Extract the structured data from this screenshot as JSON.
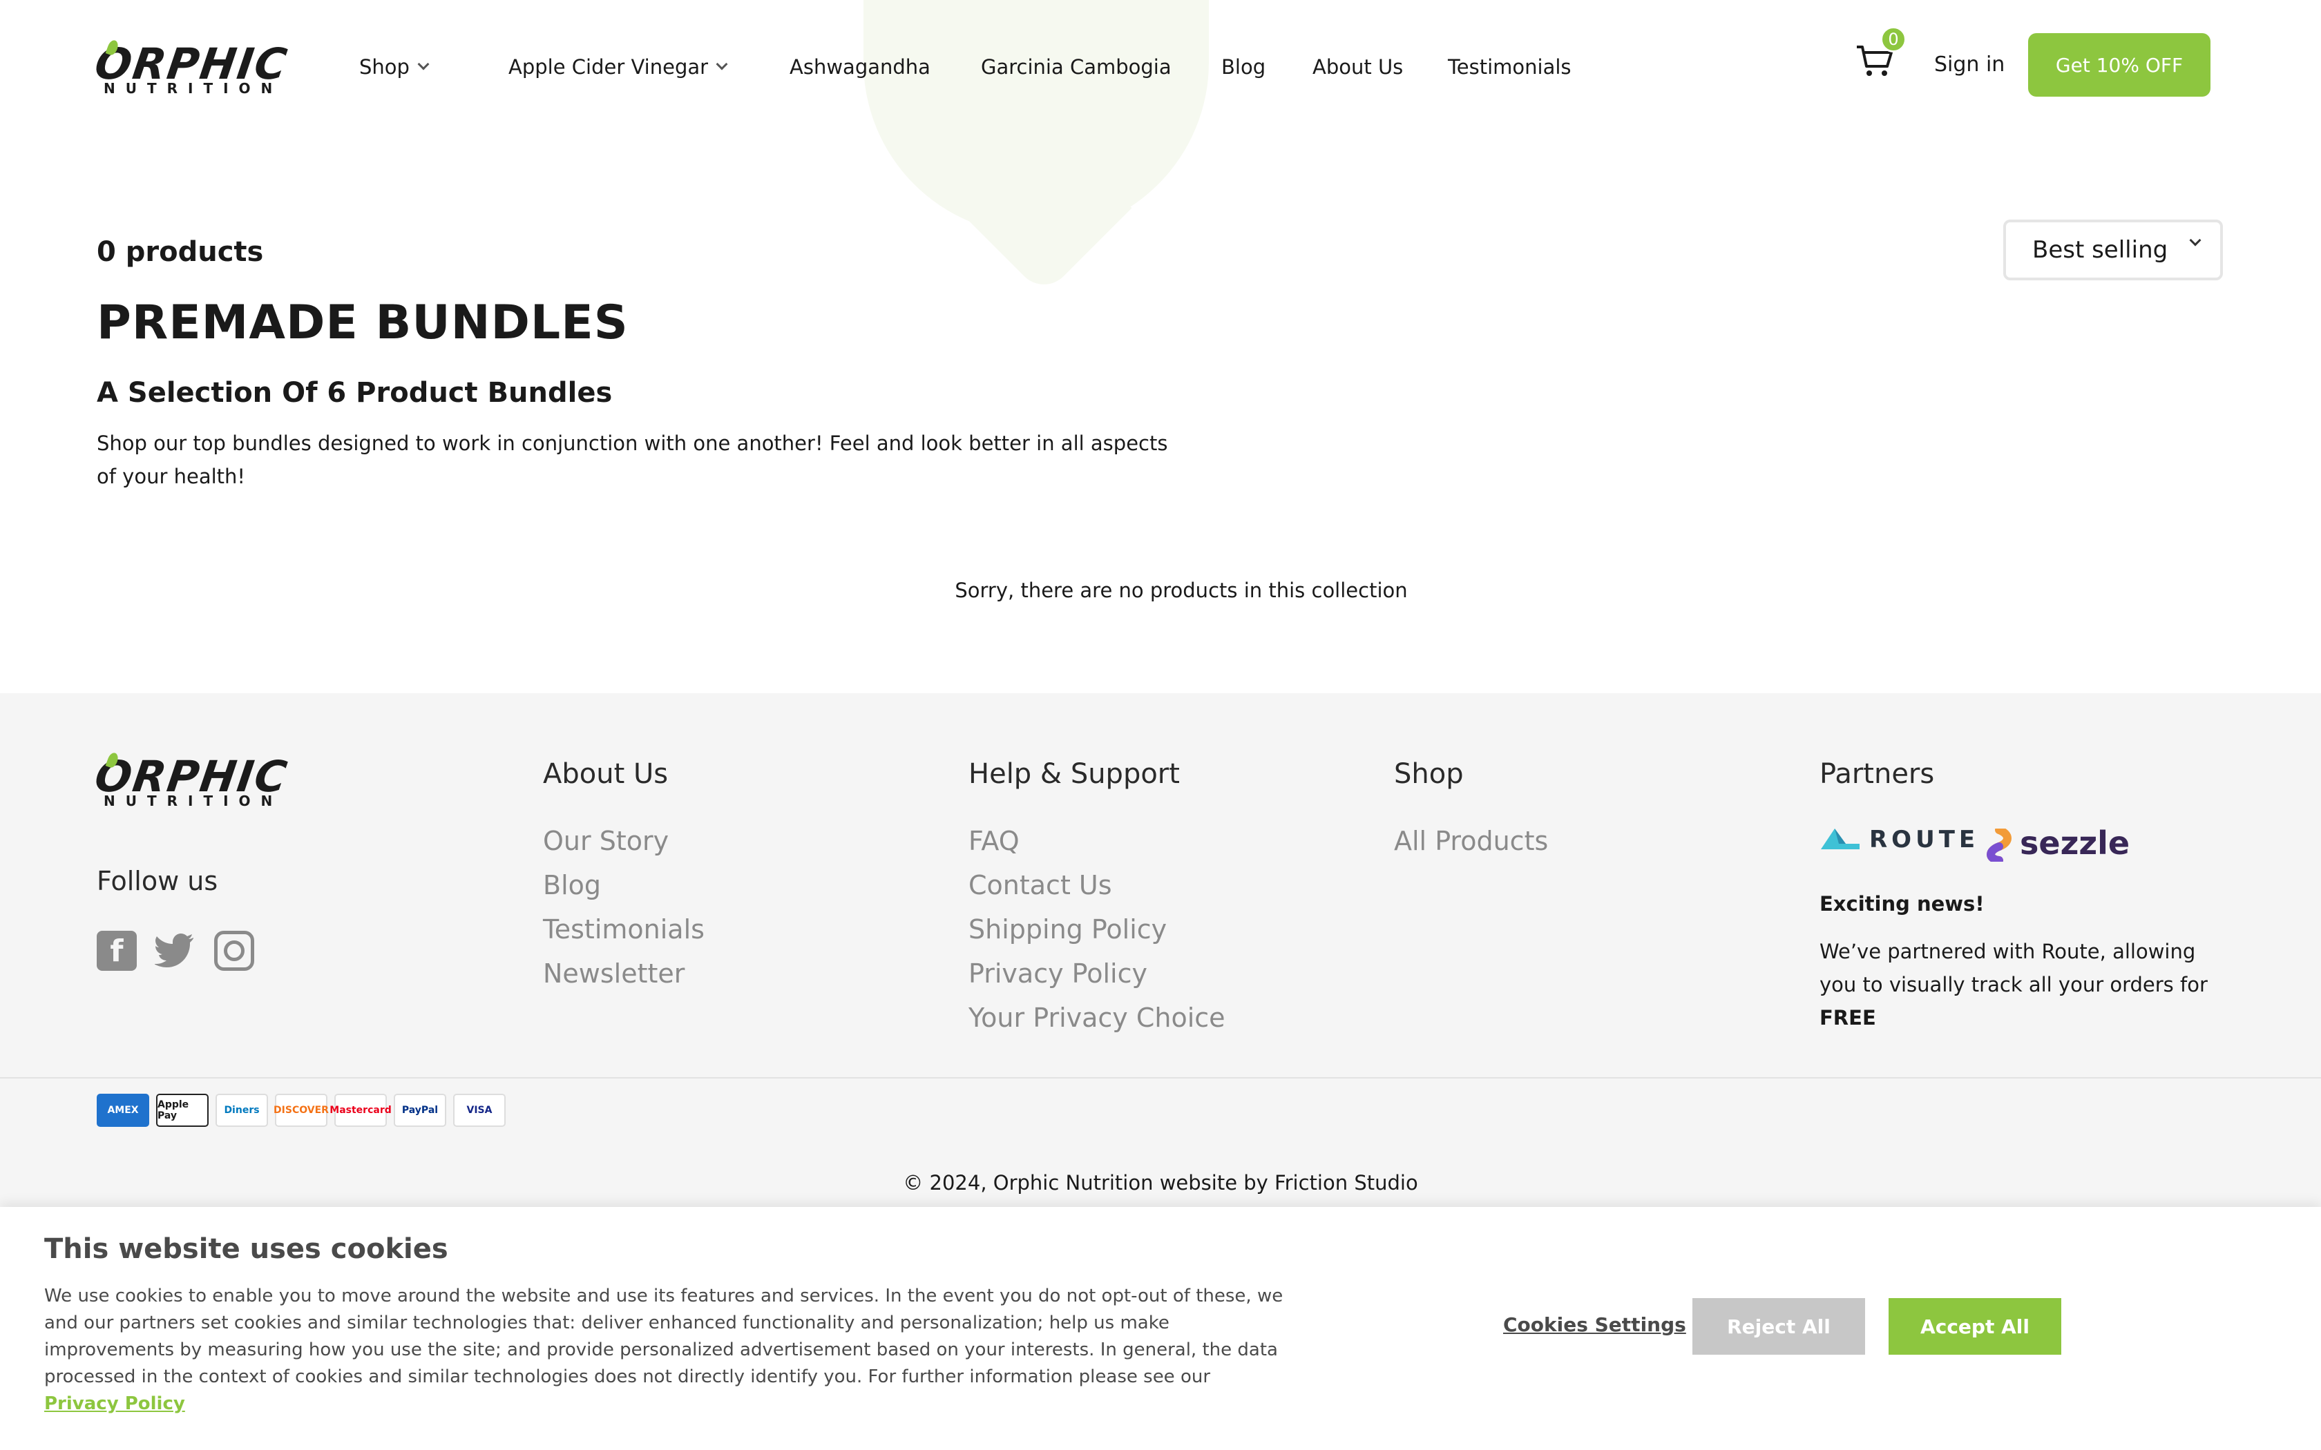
{
  "brand": {
    "name": "ORPHIC",
    "tagline": "NUTRITION",
    "accent": "#8dc63f"
  },
  "nav": {
    "items": [
      {
        "label": "Shop",
        "dropdown": true
      },
      {
        "label": "Apple Cider Vinegar",
        "dropdown": true
      },
      {
        "label": "Ashwagandha",
        "dropdown": false
      },
      {
        "label": "Garcinia Cambogia",
        "dropdown": false
      },
      {
        "label": "Blog",
        "dropdown": false
      },
      {
        "label": "About Us",
        "dropdown": false
      },
      {
        "label": "Testimonials",
        "dropdown": false
      }
    ],
    "cart_icon": "cart-icon",
    "cart_count": "0",
    "signin_label": "Sign in",
    "cta_label": "Get 10% OFF"
  },
  "collection": {
    "count_label": "0 products",
    "sort_selected": "Best selling",
    "title": "PREMADE BUNDLES",
    "subtitle": "A Selection Of 6 Product Bundles",
    "description": "Shop our top bundles designed to work in conjunction with one another! Feel and look better in all aspects of your health!",
    "empty_message": "Sorry, there are no products in this collection"
  },
  "footer": {
    "follow_label": "Follow us",
    "social_icons": [
      "facebook-icon",
      "twitter-icon",
      "instagram-icon"
    ],
    "columns": [
      {
        "heading": "About Us",
        "links": [
          "Our Story",
          "Blog",
          "Testimonials",
          "Newsletter"
        ]
      },
      {
        "heading": "Help & Support",
        "links": [
          "FAQ",
          "Contact Us",
          "Shipping Policy",
          "Privacy Policy",
          "Your Privacy Choice"
        ]
      },
      {
        "heading": "Shop",
        "links": [
          "All Products"
        ]
      }
    ],
    "partners": {
      "heading": "Partners",
      "logos": [
        "ROUTE",
        "sezzle"
      ],
      "news_heading": "Exciting news!",
      "news_text": "We’ve partnered with Route, allowing you to visually track all your orders for ",
      "news_emphasis": "FREE"
    },
    "payment_methods": [
      "AMEX",
      "Apple Pay",
      "Diners",
      "DISCOVER",
      "Mastercard",
      "PayPal",
      "VISA"
    ],
    "copyright": "© 2024, Orphic Nutrition website by Friction Studio"
  },
  "cookie_banner": {
    "title": "This website uses cookies",
    "body": "We use cookies to enable you to move around the website and use its features and services. In the event you do not opt-out of these, we and our partners set cookies and similar technologies that: deliver enhanced functionality and personalization; help us make improvements by measuring how you use the site; and provide personalized advertisement based on your interests. In general, the data processed in the context of cookies and similar technologies does not directly identify you. For further information please see our ",
    "policy_link": "Privacy Policy",
    "settings_label": "Cookies Settings",
    "reject_label": "Reject All",
    "accept_label": "Accept All"
  }
}
